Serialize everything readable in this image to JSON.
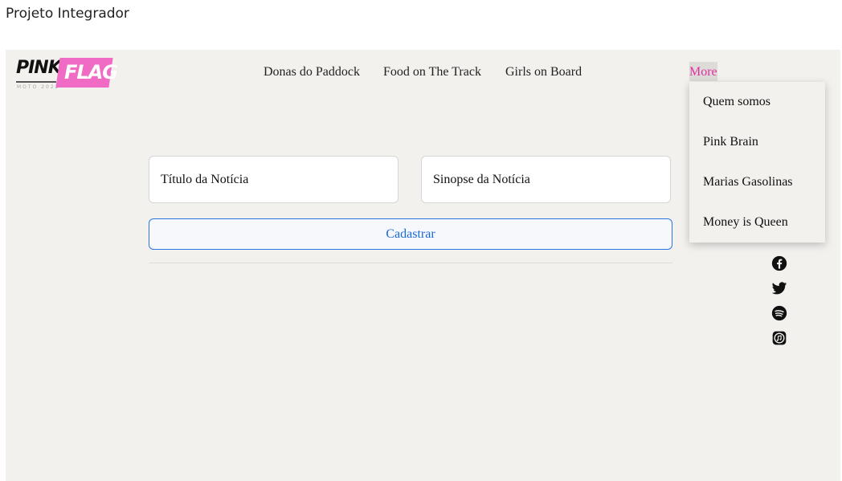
{
  "window": {
    "title": "Projeto Integrador"
  },
  "logo": {
    "word1": "PINK",
    "word2": "FLAG",
    "subtitle": "MOTO 2022"
  },
  "nav": {
    "items": [
      "Donas do Paddock",
      "Food on The Track",
      "Girls on Board"
    ],
    "more_label": "More"
  },
  "dropdown": {
    "items": [
      "Quem somos",
      "Pink Brain",
      "Marias Gasolinas",
      "Money is Queen"
    ]
  },
  "form": {
    "title_placeholder": "Título da Notícia",
    "synopsis_placeholder": "Sinopse da Notícia",
    "submit_label": "Cadastrar"
  },
  "social": {
    "icons": [
      "facebook-icon",
      "twitter-icon",
      "spotify-icon",
      "apple-music-icon"
    ]
  },
  "colors": {
    "accent": "#e0309f",
    "logo_pink": "#f06bc3",
    "button_blue": "#1a68d8",
    "background": "#f2f1ee"
  }
}
